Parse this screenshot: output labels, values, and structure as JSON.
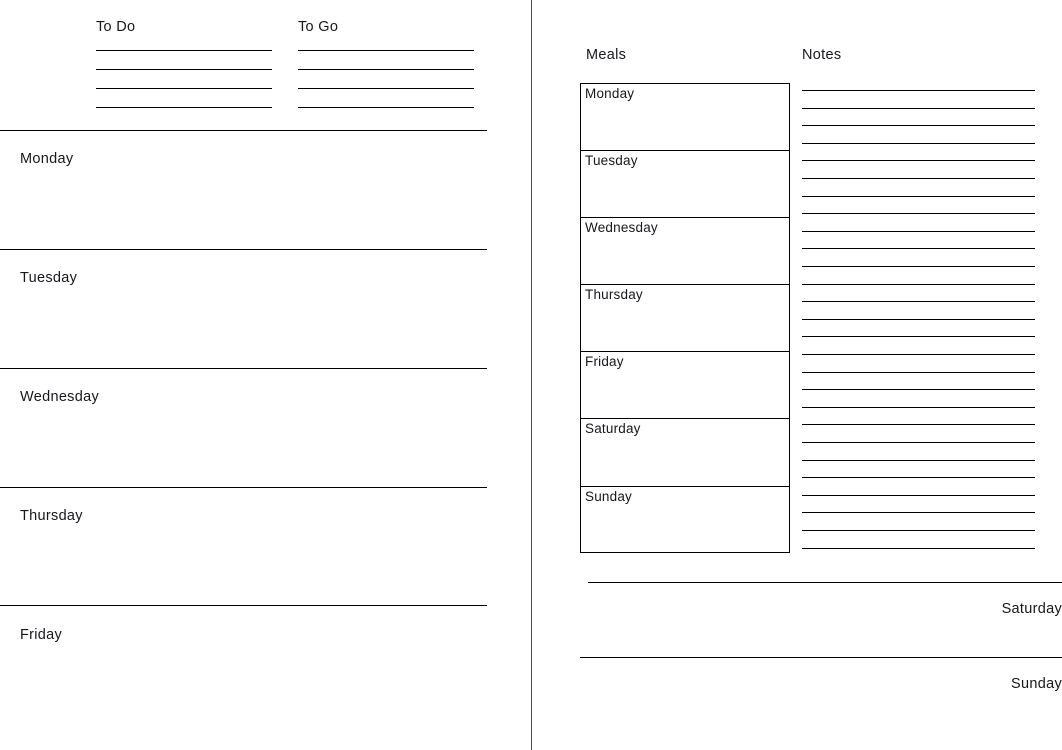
{
  "document": {
    "type": "weekly-planner-spread",
    "background_color": "#ffffff",
    "ink_color": "#000000",
    "divider_color": "#4b4e51"
  },
  "left_page": {
    "todo": {
      "heading": "To Do",
      "line_count": 4
    },
    "togo": {
      "heading": "To Go",
      "line_count": 4
    },
    "days": [
      {
        "label": "Monday"
      },
      {
        "label": "Tuesday"
      },
      {
        "label": "Wednesday"
      },
      {
        "label": "Thursday"
      },
      {
        "label": "Friday"
      }
    ]
  },
  "right_page": {
    "meals": {
      "heading": "Meals",
      "rows": [
        {
          "label": "Monday"
        },
        {
          "label": "Tuesday"
        },
        {
          "label": "Wednesday"
        },
        {
          "label": "Thursday"
        },
        {
          "label": "Friday"
        },
        {
          "label": "Saturday"
        },
        {
          "label": "Sunday"
        }
      ]
    },
    "notes": {
      "heading": "Notes",
      "line_count": 27
    },
    "weekend_days": [
      {
        "label": "Saturday"
      },
      {
        "label": "Sunday"
      }
    ]
  }
}
